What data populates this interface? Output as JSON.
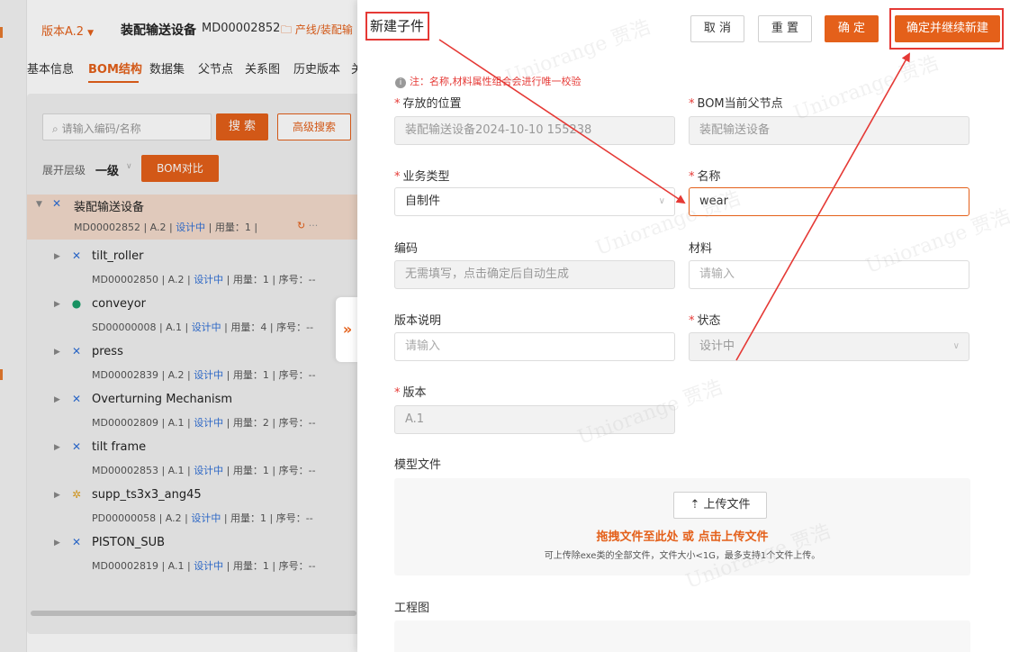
{
  "bg": {
    "version": "版本A.2",
    "product_name": "装配输送设备",
    "product_code": "MD00002852",
    "product_path": "产线/装配输",
    "tabs": [
      "基本信息",
      "BOM结构",
      "数据集",
      "父节点",
      "关系图",
      "历史版本",
      "关"
    ],
    "search_placeholder": "请输入编码/名称",
    "search_btn": "搜 索",
    "adv_search_btn": "高级搜索",
    "level_label": "展开层级",
    "level_value": "一级",
    "bom_compare_btn": "BOM对比",
    "root": {
      "name": "装配输送设备",
      "code": "MD00002852",
      "ver": "A.2",
      "status": "设计中",
      "qty": "用量：1"
    },
    "nodes": [
      {
        "name": "tilt_roller",
        "code": "MD00002850",
        "ver": "A.2",
        "status": "设计中",
        "qty": "用量：1",
        "seq": "序号：--"
      },
      {
        "name": "conveyor",
        "code": "SD00000008",
        "ver": "A.1",
        "status": "设计中",
        "qty": "用量：4",
        "seq": "序号：--"
      },
      {
        "name": "press",
        "code": "MD00002839",
        "ver": "A.2",
        "status": "设计中",
        "qty": "用量：1",
        "seq": "序号：--"
      },
      {
        "name": "Overturning Mechanism",
        "code": "MD00002809",
        "ver": "A.1",
        "status": "设计中",
        "qty": "用量：2",
        "seq": "序号：--"
      },
      {
        "name": "tilt frame",
        "code": "MD00002853",
        "ver": "A.1",
        "status": "设计中",
        "qty": "用量：1",
        "seq": "序号：--"
      },
      {
        "name": "supp_ts3x3_ang45",
        "code": "PD00000058",
        "ver": "A.2",
        "status": "设计中",
        "qty": "用量：1",
        "seq": "序号：--"
      },
      {
        "name": "PISTON_SUB",
        "code": "MD00002819",
        "ver": "A.1",
        "status": "设计中",
        "qty": "用量：1",
        "seq": "序号：--"
      }
    ]
  },
  "drawer": {
    "title": "新建子件",
    "btn_cancel": "取 消",
    "btn_reset": "重 置",
    "btn_ok": "确 定",
    "btn_ok_continue": "确定并继续新建",
    "note": "注：名称,材料属性组合会进行唯一校验",
    "fields": {
      "location": {
        "label": "存放的位置",
        "value": "装配输送设备2024-10-10 155238"
      },
      "parent": {
        "label": "BOM当前父节点",
        "value": "装配输送设备"
      },
      "biz_type": {
        "label": "业务类型",
        "value": "自制件"
      },
      "name": {
        "label": "名称",
        "value": "wear"
      },
      "code": {
        "label": "编码",
        "placeholder": "无需填写，点击确定后自动生成"
      },
      "material": {
        "label": "材料",
        "placeholder": "请输入"
      },
      "ver_desc": {
        "label": "版本说明",
        "placeholder": "请输入"
      },
      "state": {
        "label": "状态",
        "value": "设计中"
      },
      "version": {
        "label": "版本",
        "value": "A.1"
      }
    },
    "model_file_label": "模型文件",
    "upload_btn": "上传文件",
    "upload_hint1": "拖拽文件至此处 或 点击上传文件",
    "upload_hint2": "可上传除exe类的全部文件，文件大小<1G，最多支持1个文件上传。",
    "drawing_label": "工程图",
    "collapse_glyph": "»"
  },
  "watermark_text": "Uniorange 贾浩",
  "colors": {
    "accent": "#e4601a",
    "annotation": "#e53935",
    "status": "#2f6fd6"
  }
}
